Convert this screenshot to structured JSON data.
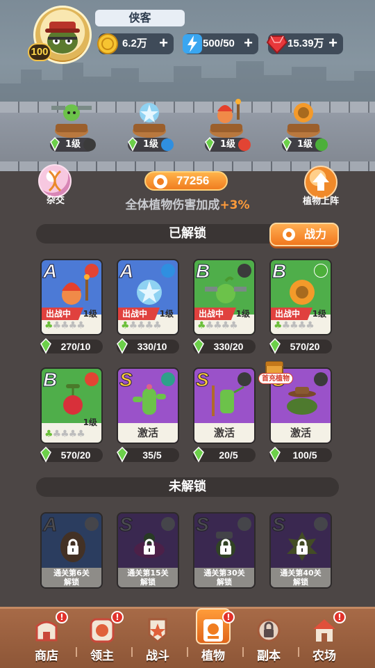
{
  "player": {
    "name": "侠客",
    "level": "100"
  },
  "resources": [
    {
      "name": "gold-coin-icon",
      "value": "6.2万"
    },
    {
      "name": "energy-icon",
      "value": "500/50"
    },
    {
      "name": "gem-icon",
      "value": "15.39万"
    }
  ],
  "deployed": [
    {
      "level": "1级",
      "element": "wind"
    },
    {
      "level": "1级",
      "element": "ice"
    },
    {
      "level": "1级",
      "element": "fire"
    },
    {
      "level": "1级",
      "element": "nature"
    }
  ],
  "hybrid": {
    "label": "杂交"
  },
  "deploy": {
    "label": "植物上阵"
  },
  "power": {
    "value": "77256"
  },
  "bonus": {
    "text": "全体植物伤害加成",
    "pct": "+3%"
  },
  "unlocked_section": {
    "title": "已解锁",
    "power_button": "战力"
  },
  "unlocked": [
    {
      "grade": "A",
      "element": "fire",
      "status": "出战中",
      "level": "1级",
      "shards": "270/10",
      "bg": "#4c7ad6"
    },
    {
      "grade": "A",
      "element": "ice",
      "status": "出战中",
      "level": "1级",
      "shards": "330/10",
      "bg": "#4c7ad6"
    },
    {
      "grade": "B",
      "element": "wind",
      "status": "出战中",
      "level": "1级",
      "shards": "330/20",
      "bg": "#4fae4a"
    },
    {
      "grade": "B",
      "element": "nature",
      "status": "出战中",
      "level": "1级",
      "shards": "570/20",
      "bg": "#4fae4a"
    },
    {
      "grade": "B",
      "element": "fire",
      "level": "1级",
      "shards": "570/20",
      "bg": "#4fae4a"
    },
    {
      "grade": "S",
      "element": "water",
      "activate": "激活",
      "shards": "35/5",
      "bg": "#9a52c9"
    },
    {
      "grade": "S",
      "element": "wind",
      "activate": "激活",
      "shards": "20/5",
      "bg": "#9a52c9"
    },
    {
      "grade": "S",
      "element": "wind",
      "activate": "激活",
      "shards": "100/5",
      "bg": "#9a52c9",
      "tag": "首充植物"
    }
  ],
  "locked_section": {
    "title": "未解锁"
  },
  "locked": [
    {
      "grade": "A",
      "element": "nature",
      "line1": "通关第6关",
      "line2": "解锁"
    },
    {
      "grade": "S",
      "element": "cloud",
      "line1": "通关第15关",
      "line2": "解锁"
    },
    {
      "grade": "S",
      "element": "wind",
      "line1": "通关第30关",
      "line2": "解锁"
    },
    {
      "grade": "S",
      "element": "cloud",
      "line1": "通关第40关",
      "line2": "解锁"
    }
  ],
  "nav": [
    {
      "label": "商店",
      "badge": "!"
    },
    {
      "label": "领主",
      "badge": "!"
    },
    {
      "label": "战斗",
      "badge": ""
    },
    {
      "label": "植物",
      "badge": "!"
    },
    {
      "label": "副本",
      "badge": ""
    },
    {
      "label": "农场",
      "badge": "!"
    }
  ]
}
